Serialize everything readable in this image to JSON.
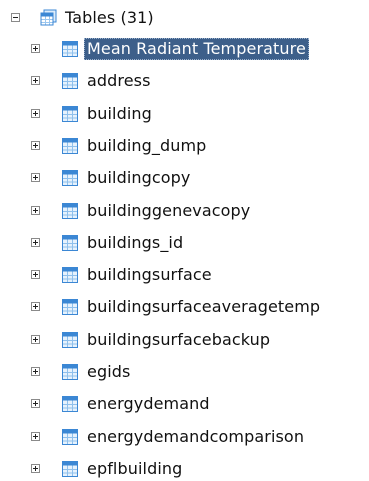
{
  "tree": {
    "root": {
      "label": "Tables (31)",
      "expanded": true,
      "icon": "tables-folder-icon"
    },
    "items": [
      {
        "label": "Mean Radiant Temperature",
        "selected": true,
        "icon": "table-icon"
      },
      {
        "label": "address",
        "icon": "table-icon"
      },
      {
        "label": "building",
        "icon": "table-icon"
      },
      {
        "label": "building_dump",
        "icon": "table-icon"
      },
      {
        "label": "buildingcopy",
        "icon": "table-icon"
      },
      {
        "label": "buildinggenevacopy",
        "icon": "table-icon"
      },
      {
        "label": "buildings_id",
        "icon": "table-icon"
      },
      {
        "label": "buildingsurface",
        "icon": "table-icon"
      },
      {
        "label": "buildingsurfaceaveragetemp",
        "icon": "table-icon"
      },
      {
        "label": "buildingsurfacebackup",
        "icon": "table-icon"
      },
      {
        "label": "egids",
        "icon": "table-icon"
      },
      {
        "label": "energydemand",
        "icon": "table-icon"
      },
      {
        "label": "energydemandcomparison",
        "icon": "table-icon"
      },
      {
        "label": "epflbuilding",
        "icon": "table-icon"
      }
    ]
  },
  "colors": {
    "selection": "#3d5f8a",
    "icon_blue": "#3b87d4",
    "icon_light": "#cfe6fb"
  }
}
